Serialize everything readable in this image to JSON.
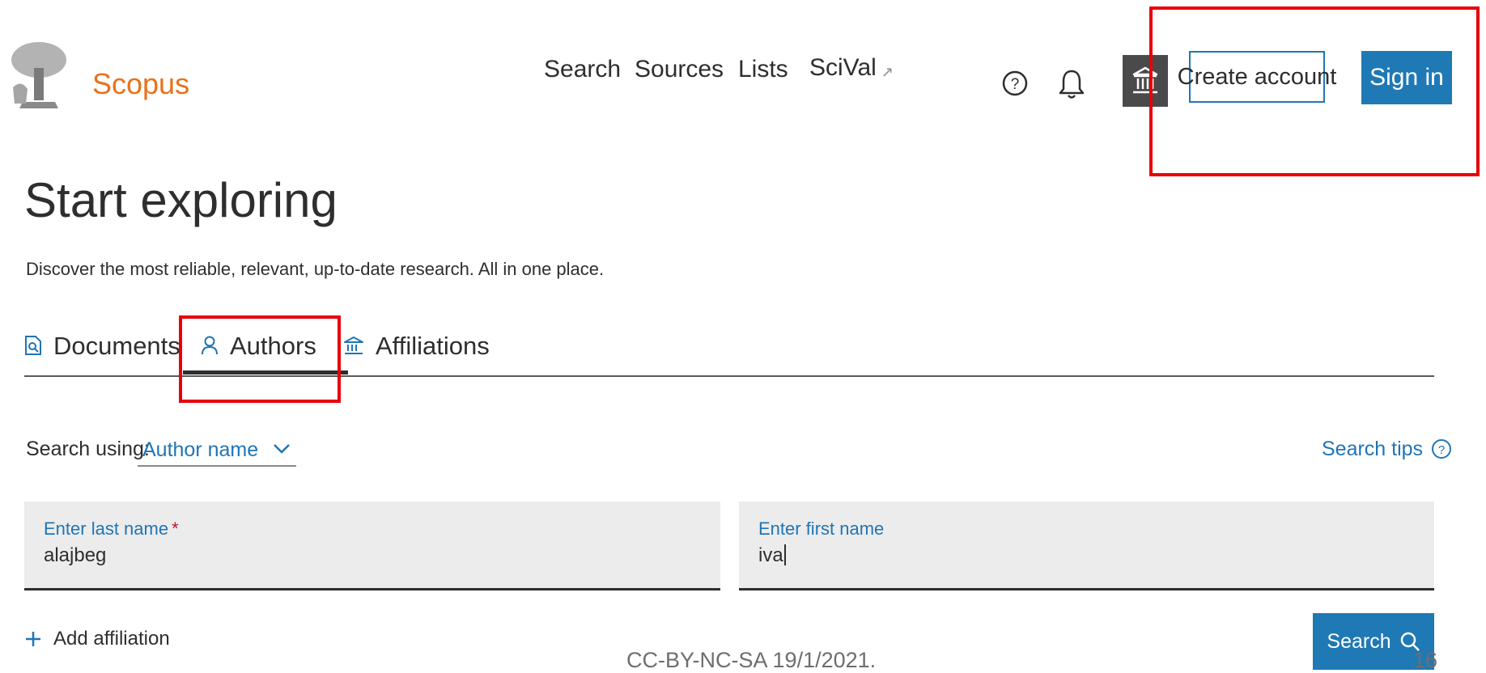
{
  "header": {
    "brand": "Scopus",
    "nav": [
      {
        "label": "Search"
      },
      {
        "label": "Sources"
      },
      {
        "label": "Lists"
      },
      {
        "label": "SciVal",
        "external_icon": "external-arrow-icon"
      }
    ],
    "icons": [
      "help-icon",
      "bell-icon",
      "institution-icon"
    ],
    "create_account_label": "Create account",
    "sign_in_label": "Sign in"
  },
  "main": {
    "title": "Start exploring",
    "subtitle": "Discover the most reliable, relevant, up-to-date research. All in one place.",
    "tabs": [
      {
        "label": "Documents",
        "icon": "document-search-icon",
        "active": false
      },
      {
        "label": "Authors",
        "icon": "person-icon",
        "active": true
      },
      {
        "label": "Affiliations",
        "icon": "institution-icon",
        "active": false
      }
    ],
    "search_using": {
      "label": "Search using:",
      "value": "Author name"
    },
    "search_tips_label": "Search tips",
    "fields": {
      "last_name": {
        "label": "Enter last name",
        "required_mark": "*",
        "value": "alajbeg"
      },
      "first_name": {
        "label": "Enter first name",
        "value": "iva"
      }
    },
    "add_affiliation_label": "Add affiliation",
    "search_button_label": "Search"
  },
  "footer": {
    "license": "CC-BY-NC-SA 19/1/2021.",
    "page_number": "16"
  },
  "colors": {
    "brand": "#e9711c",
    "primary": "#1f79b5",
    "link": "#1f75b5",
    "highlight": "#e8000a",
    "field_bg": "#ececec"
  }
}
